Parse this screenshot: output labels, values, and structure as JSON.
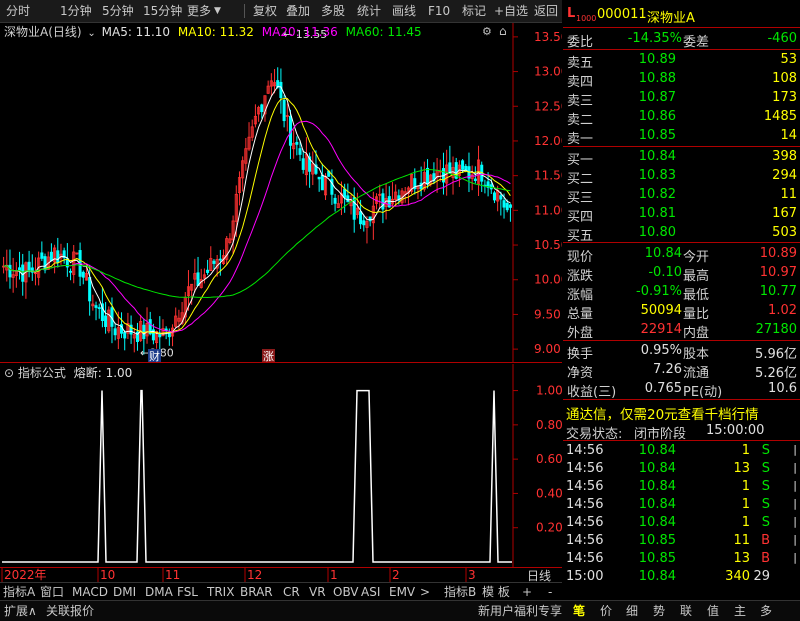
{
  "toolbar": {
    "items": [
      "分时",
      "1分钟",
      "5分钟",
      "15分钟",
      "更多",
      "复权",
      "叠加",
      "多股",
      "统计",
      "画线",
      "F10",
      "标记",
      "+自选",
      "返回"
    ]
  },
  "chart_header": {
    "stock": "深物业A(日线)",
    "ma5": "MA5: 11.10",
    "ma10": "MA10: 11.32",
    "ma20": "MA20: 11.36",
    "ma60": "MA60: 11.45"
  },
  "sub_header": {
    "title": "指标公式",
    "formula": "熔断: 1.00"
  },
  "chart_data": {
    "type": "candlestick",
    "price_axis": [
      13.5,
      13.0,
      12.5,
      12.0,
      11.5,
      11.0,
      10.5,
      10.0,
      9.5,
      9.0
    ],
    "ylim": [
      8.8,
      13.7
    ],
    "high_label": "13.55",
    "low_label": "8.80",
    "markers": [
      "财",
      "涨"
    ],
    "x_labels": [
      "2022年",
      "10",
      "11",
      "12",
      "1",
      "2",
      "3"
    ],
    "sub_axis": [
      "1.00",
      "0.80",
      "0.60",
      "0.40",
      "0.20"
    ],
    "sub_ylim": [
      0,
      1.05
    ],
    "colors": {
      "up": "#ff3232",
      "down": "#00ffff",
      "ma5": "#ffffff",
      "ma10": "#ffff00",
      "ma20": "#ff00ff",
      "ma60": "#00e600"
    }
  },
  "right": {
    "code": "000011",
    "name": "深物业A",
    "wb_label": "委比",
    "wb_value": "-14.35%",
    "wc_label": "委差",
    "wc_value": "-460",
    "sell": [
      {
        "label": "卖五",
        "price": "10.89",
        "vol": "53"
      },
      {
        "label": "卖四",
        "price": "10.88",
        "vol": "108"
      },
      {
        "label": "卖三",
        "price": "10.87",
        "vol": "173"
      },
      {
        "label": "卖二",
        "price": "10.86",
        "vol": "1485"
      },
      {
        "label": "卖一",
        "price": "10.85",
        "vol": "14"
      }
    ],
    "buy": [
      {
        "label": "买一",
        "price": "10.84",
        "vol": "398"
      },
      {
        "label": "买二",
        "price": "10.83",
        "vol": "294"
      },
      {
        "label": "买三",
        "price": "10.82",
        "vol": "11"
      },
      {
        "label": "买四",
        "price": "10.81",
        "vol": "167"
      },
      {
        "label": "买五",
        "price": "10.80",
        "vol": "503"
      }
    ],
    "quote": [
      {
        "l1": "现价",
        "v1": "10.84",
        "l2": "今开",
        "v2": "10.89"
      },
      {
        "l1": "涨跌",
        "v1": "-0.10",
        "l2": "最高",
        "v2": "10.97"
      },
      {
        "l1": "涨幅",
        "v1": "-0.91%",
        "l2": "最低",
        "v2": "10.77"
      },
      {
        "l1": "总量",
        "v1": "50094",
        "l2": "量比",
        "v2": "1.02"
      },
      {
        "l1": "外盘",
        "v1": "22914",
        "l2": "内盘",
        "v2": "27180"
      }
    ],
    "info": [
      {
        "l1": "换手",
        "v1": "0.95%",
        "l2": "股本",
        "v2": "5.96亿"
      },
      {
        "l1": "净资",
        "v1": "7.26",
        "l2": "流通",
        "v2": "5.26亿"
      },
      {
        "l1": "收益(三)",
        "v1": "0.765",
        "l2": "PE(动)",
        "v2": "10.6"
      }
    ],
    "ad": "通达信，仅需20元查看千档行情",
    "status_label": "交易状态:",
    "status_value": "闭市阶段",
    "status_time": "15:00:00",
    "ticks": [
      {
        "t": "14:56",
        "p": "10.84",
        "v": "1",
        "s": "S"
      },
      {
        "t": "14:56",
        "p": "10.84",
        "v": "13",
        "s": "S"
      },
      {
        "t": "14:56",
        "p": "10.84",
        "v": "1",
        "s": "S"
      },
      {
        "t": "14:56",
        "p": "10.84",
        "v": "1",
        "s": "S"
      },
      {
        "t": "14:56",
        "p": "10.84",
        "v": "1",
        "s": "S"
      },
      {
        "t": "14:56",
        "p": "10.85",
        "v": "11",
        "s": "B"
      },
      {
        "t": "14:56",
        "p": "10.85",
        "v": "13",
        "s": "B"
      },
      {
        "t": "15:00",
        "p": "10.84",
        "v": "340",
        "s": "29"
      }
    ]
  },
  "bottom": {
    "tabs1": [
      "指标A",
      "窗口",
      "MACD",
      "DMI",
      "DMA",
      "FSL",
      "TRIX",
      "BRAR",
      "CR",
      "VR",
      "OBV",
      "ASI",
      "EMV",
      ">",
      "指标B",
      "模 板"
    ],
    "tabs2": [
      "扩展∧",
      "关联报价"
    ],
    "tabs3": [
      "新用户福利专享"
    ],
    "right_tabs": [
      "笔",
      "价",
      "细",
      "势",
      "联",
      "值",
      "主",
      "多"
    ],
    "zoom_plus": "+",
    "zoom_minus": "-",
    "period": "日线"
  }
}
